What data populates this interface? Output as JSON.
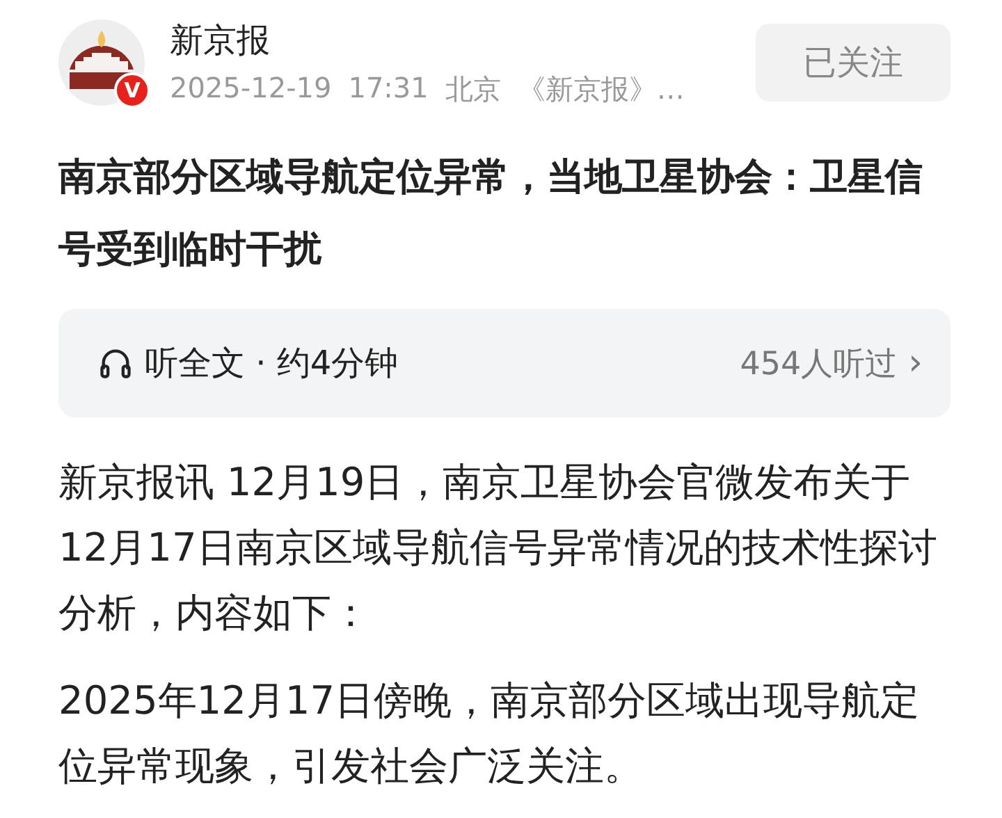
{
  "author": {
    "name": "新京报",
    "badge": "V",
    "date": "2025-12-19",
    "time": "17:31",
    "location": "北京",
    "source": "《新京报》…"
  },
  "follow_button": {
    "label": "已关注",
    "selected": true
  },
  "title": "南京部分区域导航定位异常，当地卫星协会：卫星信号受到临时干扰",
  "audio": {
    "label": "听全文 · 约4分钟",
    "listeners": "454人听过",
    "chevron": "›"
  },
  "paragraphs": [
    "新京报讯 12月19日，南京卫星协会官微发布关于12月17日南京区域导航信号异常情况的技术性探讨分析，内容如下：",
    "2025年12月17日傍晚，南京部分区域出现导航定位异常现象，引发社会广泛关注。"
  ]
}
